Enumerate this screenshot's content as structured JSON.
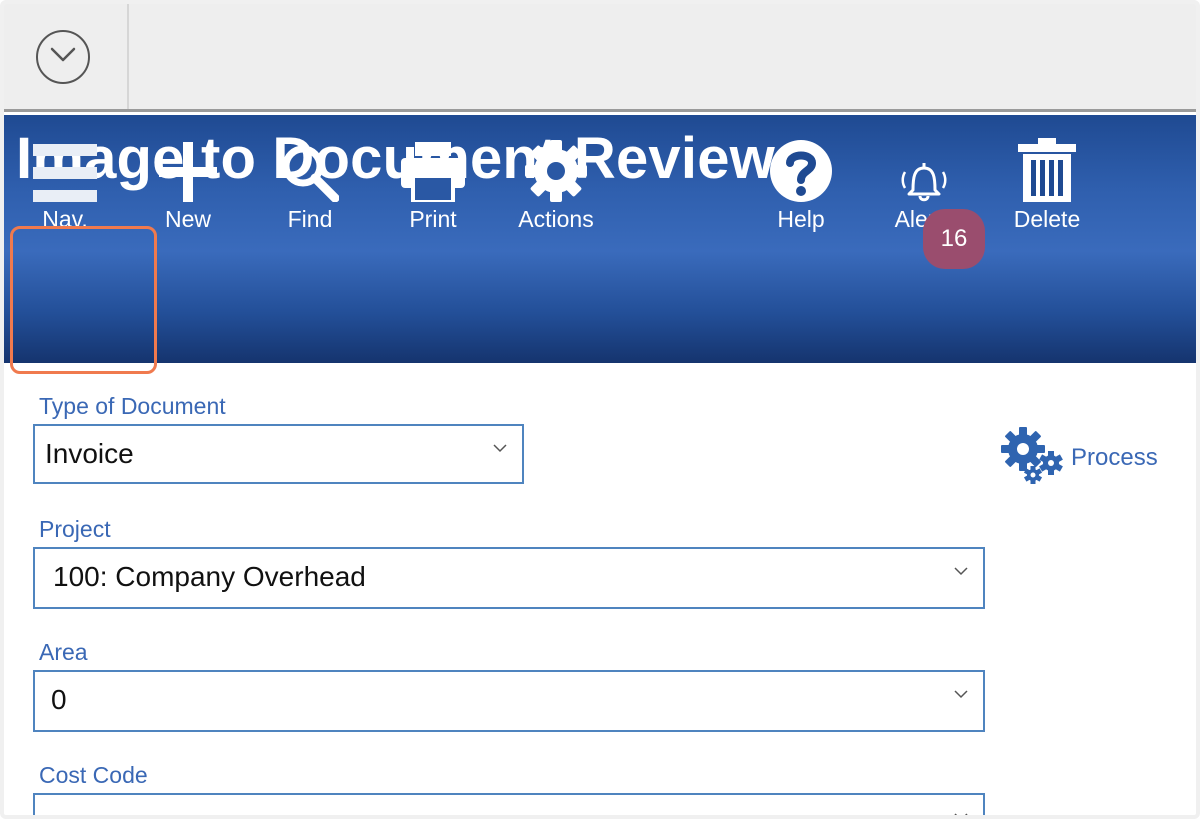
{
  "header": {
    "title": "Image to Document Review"
  },
  "toolbar": {
    "nav_label": "Nav.",
    "new_label": "New",
    "find_label": "Find",
    "print_label": "Print",
    "actions_label": "Actions",
    "help_label": "Help",
    "alerts_label": "Alerts",
    "alerts_count": "16",
    "delete_label": "Delete"
  },
  "form": {
    "type_of_document": {
      "label": "Type of Document",
      "value": "Invoice"
    },
    "project": {
      "label": "Project",
      "value": "100: Company Overhead"
    },
    "area": {
      "label": "Area",
      "value": "0"
    },
    "cost_code": {
      "label": "Cost Code",
      "value": ""
    },
    "process_label": "Process"
  },
  "colors": {
    "header_blue": "#2f5fae",
    "label_blue": "#3a68b5",
    "field_border": "#4f84bf",
    "badge": "#9a4d6e",
    "highlight": "#f07a4e"
  },
  "icons": {
    "collapse": "chevron-down-circle-icon",
    "nav": "hamburger-icon",
    "new": "plus-icon",
    "find": "search-icon",
    "print": "printer-icon",
    "actions": "gear-icon",
    "help": "question-icon",
    "alerts": "bell-icon",
    "delete": "trash-icon",
    "process": "gears-icon",
    "dropdown": "chevron-down-icon"
  }
}
